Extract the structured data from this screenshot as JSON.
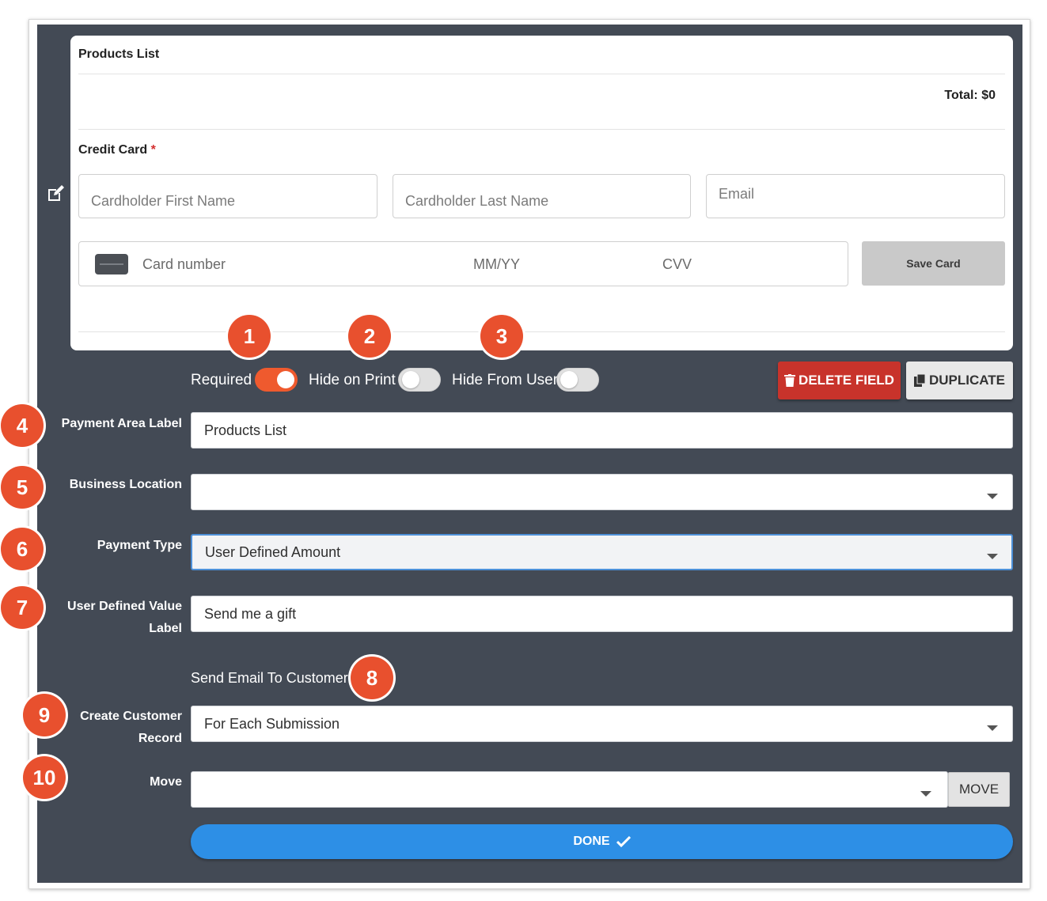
{
  "preview": {
    "section_title": "Products List",
    "total": "Total: $0",
    "credit_card_label": "Credit Card",
    "required_marker": "*",
    "first_name_placeholder": "Cardholder First Name",
    "last_name_placeholder": "Cardholder Last Name",
    "email_placeholder": "Email",
    "card_number_placeholder": "Card number",
    "expiry_placeholder": "MM/YY",
    "cvv_placeholder": "CVV",
    "save_card_label": "Save Card"
  },
  "toggles": {
    "required": {
      "label": "Required",
      "on": true
    },
    "hide_on_print": {
      "label": "Hide on Print",
      "on": false
    },
    "hide_from_user": {
      "label": "Hide From User",
      "on": false
    }
  },
  "actions": {
    "delete_label": "DELETE FIELD",
    "duplicate_label": "DUPLICATE"
  },
  "fields": {
    "payment_area_label": {
      "label": "Payment Area Label",
      "value": "Products List"
    },
    "business_location": {
      "label": "Business Location",
      "value": ""
    },
    "payment_type": {
      "label": "Payment Type",
      "value": "User Defined Amount"
    },
    "user_defined_value_label": {
      "label_line1": "User Defined Value",
      "label_line2": "Label",
      "value": "Send me a gift"
    },
    "send_email": {
      "label": "Send Email To Customer"
    },
    "create_customer_record": {
      "label_line1": "Create Customer",
      "label_line2": "Record",
      "value": "For Each Submission"
    },
    "move": {
      "label": "Move",
      "value": "",
      "button_label": "MOVE"
    }
  },
  "done_label": "DONE",
  "badges": [
    "1",
    "2",
    "3",
    "4",
    "5",
    "6",
    "7",
    "8",
    "9",
    "10"
  ],
  "colors": {
    "panel": "#434a55",
    "badge": "#e8502e",
    "toggle_on": "#ef5a2e",
    "delete": "#c8332b",
    "done": "#2d8fe6"
  }
}
